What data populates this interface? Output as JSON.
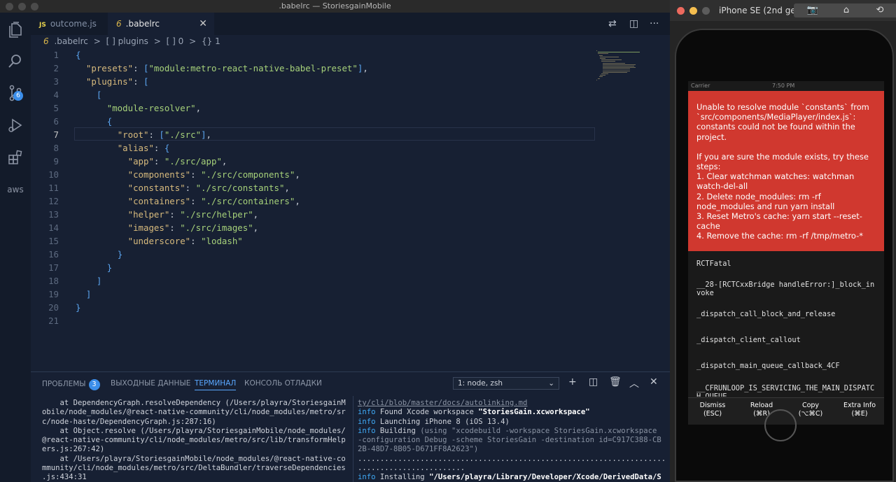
{
  "window": {
    "title": ".babelrc — StoriesgainMobile"
  },
  "activity_bar": {
    "icons": [
      "files-icon",
      "search-icon",
      "source-control-icon",
      "run-debug-icon",
      "extensions-icon",
      "aws-icon"
    ],
    "scm_badge": "6",
    "aws_label": "aws"
  },
  "tabs": [
    {
      "icon": "JS",
      "label": "outcome.js",
      "active": false
    },
    {
      "icon": "6",
      "label": ".babelrc",
      "active": true
    }
  ],
  "breadcrumb": {
    "icon": "6",
    "items": [
      ".babelrc",
      "[ ] plugins",
      "[ ] 0",
      "{} 1"
    ],
    "separator": ">"
  },
  "editor": {
    "current_line": 7,
    "lines": [
      {
        "n": "1",
        "t": "{"
      },
      {
        "n": "2",
        "t": "  \"presets\": [\"module:metro-react-native-babel-preset\"],"
      },
      {
        "n": "3",
        "t": "  \"plugins\": ["
      },
      {
        "n": "4",
        "t": "    ["
      },
      {
        "n": "5",
        "t": "      \"module-resolver\","
      },
      {
        "n": "6",
        "t": "      {"
      },
      {
        "n": "7",
        "t": "        \"root\": [\"./src\"],"
      },
      {
        "n": "8",
        "t": "        \"alias\": {"
      },
      {
        "n": "9",
        "t": "          \"app\": \"./src/app\","
      },
      {
        "n": "10",
        "t": "          \"components\": \"./src/components\","
      },
      {
        "n": "11",
        "t": "          \"constants\": \"./src/constants\","
      },
      {
        "n": "12",
        "t": "          \"containers\": \"./src/containers\","
      },
      {
        "n": "13",
        "t": "          \"helper\": \"./src/helper\","
      },
      {
        "n": "14",
        "t": "          \"images\": \"./src/images\","
      },
      {
        "n": "15",
        "t": "          \"underscore\": \"lodash\""
      },
      {
        "n": "16",
        "t": "        }"
      },
      {
        "n": "17",
        "t": "      }"
      },
      {
        "n": "18",
        "t": "    ]"
      },
      {
        "n": "19",
        "t": "  ]"
      },
      {
        "n": "20",
        "t": "}"
      },
      {
        "n": "21",
        "t": ""
      }
    ]
  },
  "panel": {
    "tabs": [
      {
        "label": "ПРОБЛЕМЫ",
        "badge": "3",
        "active": false
      },
      {
        "label": "ВЫХОДНЫЕ ДАННЫЕ",
        "active": false
      },
      {
        "label": "ТЕРМИНАЛ",
        "active": true
      },
      {
        "label": "КОНСОЛЬ ОТЛАДКИ",
        "active": false
      }
    ],
    "terminal_select": "1: node, zsh",
    "actions": [
      "add-terminal-icon",
      "split-terminal-icon",
      "trash-icon",
      "maximize-panel-icon",
      "close-panel-icon"
    ],
    "left_terminal": [
      "    at DependencyGraph.resolveDependency (/Users/playra/StoriesgainM",
      "obile/node_modules/@react-native-community/cli/node_modules/metro/sr",
      "c/node-haste/DependencyGraph.js:287:16)",
      "    at Object.resolve (/Users/playra/StoriesgainMobile/node_modules/",
      "@react-native-community/cli/node_modules/metro/src/lib/transformHelp",
      "ers.js:267:42)",
      "    at /Users/playra/StoriesgainMobile/node_modules/@react-native-co",
      "mmunity/cli/node_modules/metro/src/DeltaBundler/traverseDependencies",
      ".js:434:31"
    ],
    "right_terminal": [
      {
        "tag": "",
        "text": "ty/cli/blob/master/docs/autolinking.md",
        "style": "dim-underline"
      },
      {
        "tag": "info",
        "text": " Found Xcode workspace ",
        "bold": "\"StoriesGain.xcworkspace\""
      },
      {
        "tag": "info",
        "text": " Launching iPhone 8 (iOS 13.4)"
      },
      {
        "tag": "info",
        "text": " Building ",
        "dim": "(using \"xcodebuild -workspace StoriesGain.xcworkspace"
      },
      {
        "tag": "",
        "text": "",
        "dim": "-configuration Debug -scheme StoriesGain -destination id=C917C388-CB"
      },
      {
        "tag": "",
        "text": "",
        "dim": "2B-48D7-8B05-D671FF8A2623\")"
      },
      {
        "tag": "",
        "text": "........................................................................"
      },
      {
        "tag": "",
        "text": "........................"
      },
      {
        "tag": "info",
        "text": " Installing ",
        "bold": "\"/Users/playra/Library/Developer/Xcode/DerivedData/S"
      }
    ]
  },
  "simulator": {
    "title": "iPhone SE (2nd ge...",
    "buttons": [
      "screenshot-icon",
      "home-icon",
      "rotate-icon"
    ],
    "status_carrier": "Carrier",
    "status_time": "7:50 PM",
    "error_paragraphs": [
      "Unable to resolve module `constants` from `src/components/MediaPlayer/index.js`: constants could not be found within the project.",
      "If you are sure the module exists, try these steps:\n 1. Clear watchman watches: watchman watch-del-all\n 2. Delete node_modules: rm -rf node_modules and run yarn install\n 3. Reset Metro's cache: yarn start --reset-cache\n 4. Remove the cache: rm -rf /tmp/metro-*"
    ],
    "stack": [
      "RCTFatal",
      "__28-[RCTCxxBridge handleError:]_block_invoke",
      "_dispatch_call_block_and_release",
      "_dispatch_client_callout",
      "_dispatch_main_queue_callback_4CF",
      "__CFRUNLOOP_IS_SERVICING_THE_MAIN_DISPATCH_QUEUE__"
    ],
    "actions": [
      {
        "label": "Dismiss",
        "shortcut": "(ESC)"
      },
      {
        "label": "Reload",
        "shortcut": "(⌘R)"
      },
      {
        "label": "Copy",
        "shortcut": "(⌥⌘C)"
      },
      {
        "label": "Extra Info",
        "shortcut": "(⌘E)"
      }
    ]
  }
}
